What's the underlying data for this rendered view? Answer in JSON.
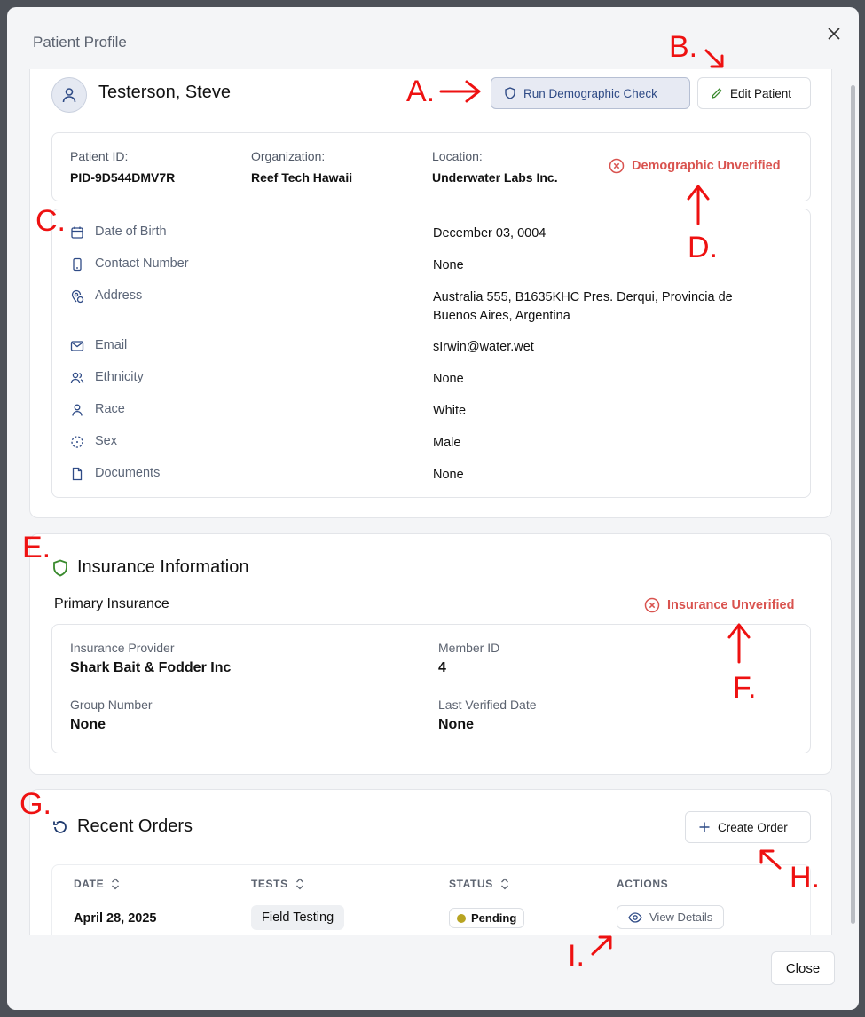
{
  "modal": {
    "title": "Patient Profile"
  },
  "patient": {
    "name": "Testerson, Steve",
    "run_check_label": "Run Demographic Check",
    "edit_label": "Edit Patient",
    "info": {
      "id_label": "Patient ID:",
      "id_value": "PID-9D544DMV7R",
      "org_label": "Organization:",
      "org_value": "Reef Tech Hawaii",
      "loc_label": "Location:",
      "loc_value": "Underwater Labs Inc."
    },
    "demographic_status": "Demographic Unverified",
    "details": [
      {
        "icon": "calendar-icon",
        "label": "Date of Birth",
        "value": "December 03, 0004"
      },
      {
        "icon": "phone-icon",
        "label": "Contact Number",
        "value": "None"
      },
      {
        "icon": "map-pin-icon",
        "label": "Address",
        "value": "Australia 555, B1635KHC Pres. Derqui, Provincia de Buenos Aires, Argentina"
      },
      {
        "icon": "mail-icon",
        "label": "Email",
        "value": "sIrwin@water.wet"
      },
      {
        "icon": "users-icon",
        "label": "Ethnicity",
        "value": "None"
      },
      {
        "icon": "user-icon",
        "label": "Race",
        "value": "White"
      },
      {
        "icon": "dashed-circle-icon",
        "label": "Sex",
        "value": "Male"
      },
      {
        "icon": "file-icon",
        "label": "Documents",
        "value": "None"
      }
    ]
  },
  "insurance": {
    "title": "Insurance Information",
    "subtitle": "Primary Insurance",
    "status": "Insurance Unverified",
    "provider_label": "Insurance Provider",
    "provider_value": "Shark Bait & Fodder Inc",
    "member_label": "Member ID",
    "member_value": "4",
    "group_label": "Group Number",
    "group_value": "None",
    "verified_label": "Last Verified Date",
    "verified_value": "None"
  },
  "orders": {
    "title": "Recent Orders",
    "create_label": "Create Order",
    "columns": [
      "DATE",
      "TESTS",
      "STATUS",
      "ACTIONS"
    ],
    "rows": [
      {
        "date": "April 28, 2025",
        "tests": "Field Testing",
        "status": "Pending",
        "action": "View Details"
      }
    ]
  },
  "footer": {
    "close_label": "Close"
  },
  "annotations": {
    "a": "A.",
    "b": "B.",
    "c": "C.",
    "d": "D.",
    "e": "E.",
    "f": "F.",
    "g": "G.",
    "h": "H.",
    "i": "I."
  },
  "colors": {
    "unverified": "#d9534f",
    "annotation": "#ee1111",
    "shield_green": "#3a8a2e",
    "pending_dot": "#b8a422"
  }
}
